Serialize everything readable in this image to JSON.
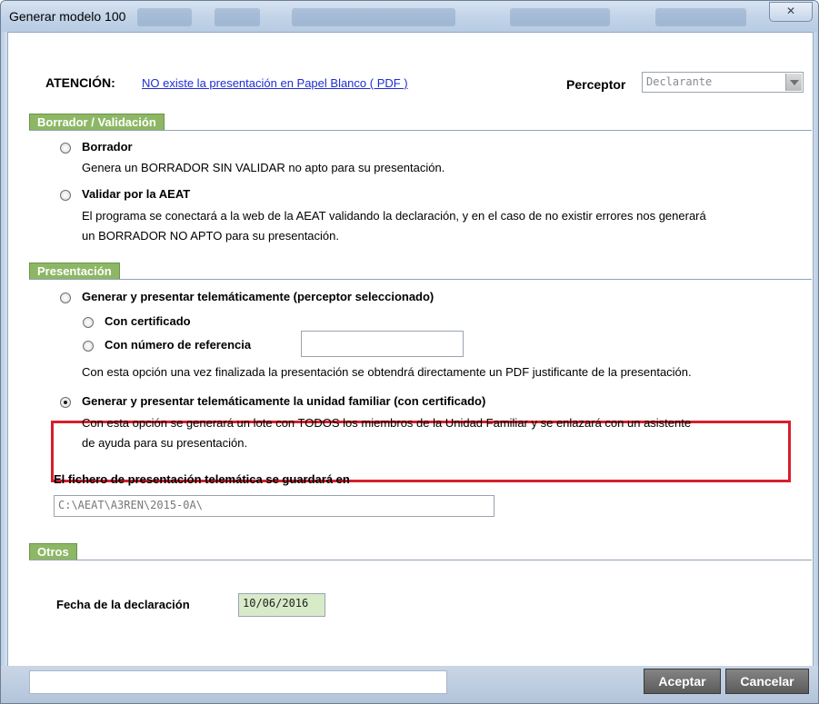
{
  "window": {
    "title": "Generar modelo 100",
    "close_glyph": "✕"
  },
  "header": {
    "attention_label": "ATENCIÓN:",
    "attention_link": "NO existe la presentación en Papel Blanco ( PDF )",
    "perceptor_label": "Perceptor",
    "perceptor_value": "Declarante"
  },
  "borrador": {
    "section_title": "Borrador / Validación",
    "option1_label": "Borrador",
    "option1_desc": "Genera un BORRADOR SIN VALIDAR no apto para su presentación.",
    "option2_label": "Validar por la AEAT",
    "option2_desc_line1": "El programa se conectará a la web de la AEAT validando la declaración, y en el caso de no existir errores nos generará",
    "option2_desc_line2": "un BORRADOR NO APTO para su presentación."
  },
  "presentacion": {
    "section_title": "Presentación",
    "option1_label": "Generar y presentar telemáticamente (perceptor seleccionado)",
    "sub1_label": "Con certificado",
    "sub2_label": "Con número de referencia",
    "reference_value": "",
    "option1_desc": "Con esta opción una vez finalizada la presentación se obtendrá directamente un PDF justificante de la presentación.",
    "option2_label": "Generar y presentar telemáticamente la unidad familiar (con certificado)",
    "option2_desc_line1": "Con esta opción se generará un lote con TODOS los miembros de la Unidad Familiar y se enlazará con un asistente",
    "option2_desc_line2": "de ayuda para su presentación.",
    "file_label": "El fichero de presentación telemática se guardará en",
    "file_path": "C:\\AEAT\\A3REN\\2015-0A\\"
  },
  "otros": {
    "section_title": "Otros",
    "date_label": "Fecha de la declaración",
    "date_value": "10/06/2016"
  },
  "footer": {
    "status_text": "",
    "accept_label": "Aceptar",
    "cancel_label": "Cancelar"
  },
  "colors": {
    "section_tab": "#8db765",
    "highlight_border": "#d61f2b",
    "link": "#1f2dd6",
    "date_field_bg": "#d8ebc9"
  }
}
